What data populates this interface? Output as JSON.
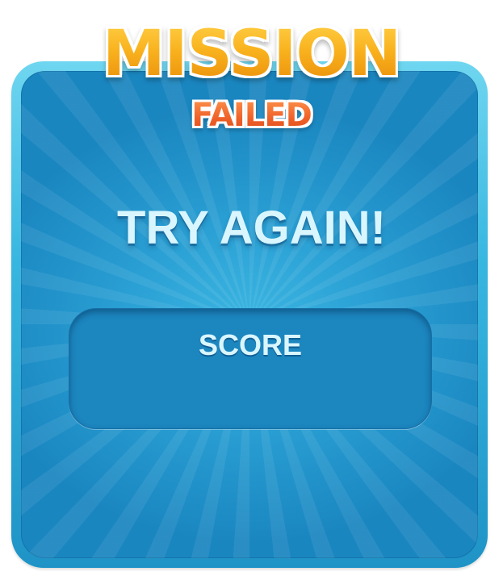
{
  "dialog": {
    "title": "MISSION",
    "subtitle": "FAILED",
    "message": "TRY AGAIN!",
    "score": {
      "label": "SCORE",
      "value": ""
    }
  },
  "colors": {
    "panel": "#2aa0d4",
    "panel_rim": "#5fd0ee",
    "title": "#f9b21e",
    "subtitle": "#f0632a",
    "text": "#d9f6ff"
  }
}
